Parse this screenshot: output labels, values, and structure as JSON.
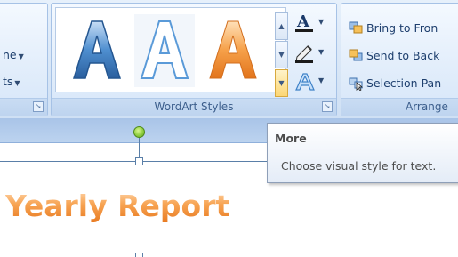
{
  "ribbon": {
    "left_group": {
      "row1": "ne",
      "row2": "ts"
    },
    "wordart_styles": {
      "label": "WordArt Styles",
      "tiles": [
        "A",
        "A",
        "A"
      ],
      "fill_tool_letter": "A"
    },
    "arrange": {
      "label": "Arrange",
      "items": [
        "Bring to Fron",
        "Send to Back",
        "Selection Pan"
      ]
    }
  },
  "document": {
    "text": "Yearly Report"
  },
  "tooltip": {
    "title": "More",
    "description": "Choose visual style for text."
  },
  "colors": {
    "ribbon_text": "#15428b",
    "wordart_blue": "#3f7fc4",
    "wordart_orange": "#f39a46",
    "rotation_handle": "#8acb3b"
  }
}
